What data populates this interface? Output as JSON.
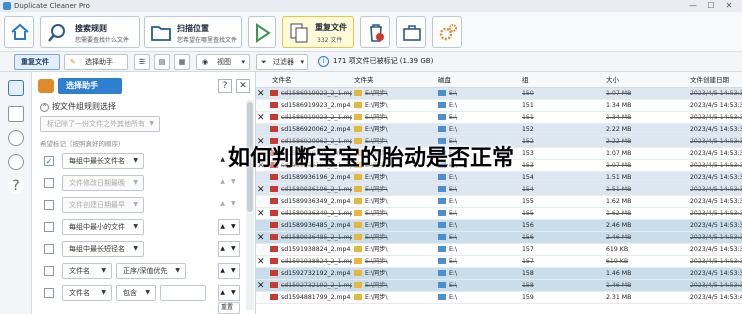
{
  "app": {
    "title": "Duplicate Cleaner Pro",
    "window_controls": [
      "—",
      "☐",
      "✕"
    ]
  },
  "ribbon": {
    "scan_rules_title": "搜索规则",
    "scan_rules_sub": "您需要查找什么文件",
    "scan_location_title": "扫描位置",
    "scan_location_sub": "您希望在哪里查找文件",
    "duplicates_title": "重复文件",
    "duplicates_count": "332 文件"
  },
  "toolbar": {
    "duplicates_tab": "重复文件",
    "selection_helper": "选择助手",
    "view_label": "视图",
    "filter_label": "过滤器",
    "marked_status": "171 项文件已被标记 (1.39 GB)"
  },
  "panel": {
    "helper_title": "选择助手",
    "help_btn": "?",
    "close_btn": "✕",
    "section": "按文件组规则选择",
    "mark_all_dropdown": "标记除了一份文件之外其他所有",
    "priority_hint": "希望标记（按照真好的顺序）",
    "rules": [
      {
        "checked": true,
        "label": "每组中最长文件名",
        "disabled": false
      },
      {
        "checked": false,
        "label": "文件修改日期最晚",
        "disabled": true
      },
      {
        "checked": false,
        "label": "文件创建日期最早",
        "disabled": true
      },
      {
        "checked": false,
        "label": "每组中最小的文件",
        "disabled": false
      },
      {
        "checked": false,
        "label": "每组中最长短径名",
        "disabled": false
      }
    ],
    "filename_rule": {
      "field": "文件名",
      "mode": "正序/深值优先"
    },
    "filename_rule2": {
      "field": "文件名",
      "mode": "包含"
    },
    "reset": "重置"
  },
  "grid": {
    "columns": [
      "文件名",
      "文件夹",
      "磁盘",
      "组",
      "大小",
      "文件创建日期"
    ],
    "rows": [
      {
        "mark": true,
        "name": "sd1586919923_2_1.mp4",
        "folder": "E:\\同步\\",
        "disk": "E:\\",
        "group": "150",
        "size": "1.07 MB",
        "date": "2023/4/5 14:53:3",
        "style": "g1",
        "strike": true
      },
      {
        "mark": false,
        "name": "sd1586919923_2.mp4",
        "folder": "E:\\同步\\",
        "disk": "E:\\",
        "group": "151",
        "size": "1.34 MB",
        "date": "2023/4/5 14:53:3",
        "style": "",
        "strike": false
      },
      {
        "mark": true,
        "name": "sd1586919923_2_1.mp4",
        "folder": "E:\\同步\\",
        "disk": "E:\\",
        "group": "151",
        "size": "1.34 MB",
        "date": "2023/4/5 14:53:3",
        "style": "",
        "strike": true
      },
      {
        "mark": false,
        "name": "sd1586920062_2.mp4",
        "folder": "E:\\同步\\",
        "disk": "E:\\",
        "group": "152",
        "size": "2.22 MB",
        "date": "2023/4/5 14:53:3",
        "style": "g1",
        "strike": false
      },
      {
        "mark": true,
        "name": "sd1586920062_2_1.mp4",
        "folder": "E:\\同步\\",
        "disk": "E:\\",
        "group": "152",
        "size": "2.22 MB",
        "date": "2023/4/5 14:53:3",
        "style": "g1",
        "strike": true
      },
      {
        "mark": false,
        "name": "sd1589936196_2.mp4",
        "folder": "E:\\同步\\",
        "disk": "E:\\",
        "group": "153",
        "size": "1.07 MB",
        "date": "2023/4/5 14:53:3",
        "style": "",
        "strike": false
      },
      {
        "mark": true,
        "name": "sd1589936196_2_1.mp4",
        "folder": "E:\\同步\\",
        "disk": "E:\\",
        "group": "153",
        "size": "1.07 MB",
        "date": "2023/4/5 14:53:3",
        "style": "",
        "strike": true
      },
      {
        "mark": false,
        "name": "sd1589936196_2.mp4",
        "folder": "E:\\同步\\",
        "disk": "E:\\",
        "group": "154",
        "size": "1.51 MB",
        "date": "2023/4/5 14:53:3",
        "style": "g1",
        "strike": false
      },
      {
        "mark": true,
        "name": "sd1589936196_2_1.mp4",
        "folder": "E:\\同步\\",
        "disk": "E:\\",
        "group": "154",
        "size": "1.51 MB",
        "date": "2023/4/5 14:53:3",
        "style": "g1",
        "strike": true
      },
      {
        "mark": false,
        "name": "sd1589936349_2.mp4",
        "folder": "E:\\同步\\",
        "disk": "E:\\",
        "group": "155",
        "size": "1.62 MB",
        "date": "2023/4/5 14:53:3",
        "style": "",
        "strike": false
      },
      {
        "mark": true,
        "name": "sd1589936349_2_1.mp4",
        "folder": "E:\\同步\\",
        "disk": "E:\\",
        "group": "155",
        "size": "1.62 MB",
        "date": "2023/4/5 14:53:3",
        "style": "",
        "strike": true
      },
      {
        "mark": false,
        "name": "sd1589936485_2.mp4",
        "folder": "E:\\同步\\",
        "disk": "E:\\",
        "group": "156",
        "size": "2.46 MB",
        "date": "2023/4/5 14:53:3",
        "style": "g2",
        "strike": false
      },
      {
        "mark": true,
        "name": "sd1589936485_2_1.mp4",
        "folder": "E:\\同步\\",
        "disk": "E:\\",
        "group": "156",
        "size": "2.46 MB",
        "date": "2023/4/5 14:53:3",
        "style": "g2",
        "strike": true
      },
      {
        "mark": false,
        "name": "sd1591938824_2.mp4",
        "folder": "E:\\同步\\",
        "disk": "E:\\",
        "group": "157",
        "size": "619 KB",
        "date": "2023/4/5 14:53:3",
        "style": "",
        "strike": false
      },
      {
        "mark": true,
        "name": "sd1591938824_2_1.mp4",
        "folder": "E:\\同步\\",
        "disk": "E:\\",
        "group": "157",
        "size": "619 KB",
        "date": "2023/4/5 14:53:3",
        "style": "",
        "strike": true
      },
      {
        "mark": false,
        "name": "sd1592732192_2.mp4",
        "folder": "E:\\同步\\",
        "disk": "E:\\",
        "group": "158",
        "size": "1.46 MB",
        "date": "2023/4/5 14:53:3",
        "style": "g2",
        "strike": false
      },
      {
        "mark": true,
        "name": "sd1592732192_2_1.mp4",
        "folder": "E:\\同步\\",
        "disk": "E:\\",
        "group": "158",
        "size": "1.46 MB",
        "date": "2023/4/5 14:53:3",
        "style": "g2",
        "strike": true
      },
      {
        "mark": false,
        "name": "sd1594881799_2.mp4",
        "folder": "E:\\同步\\",
        "disk": "E:\\",
        "group": "159",
        "size": "2.31 MB",
        "date": "2023/4/5 14:53:4",
        "style": "",
        "strike": false
      }
    ]
  },
  "overlay_caption": "如何判断宝宝的胎动是否正常"
}
